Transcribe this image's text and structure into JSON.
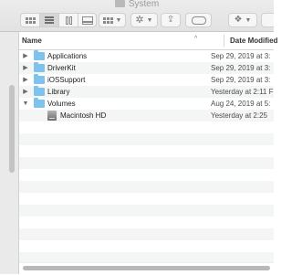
{
  "window": {
    "title": "System"
  },
  "toolbar": {
    "view_modes": [
      {
        "name": "icon-view",
        "icon": "grid-icon",
        "active": false
      },
      {
        "name": "list-view",
        "icon": "list-icon",
        "active": true
      },
      {
        "name": "column-view",
        "icon": "columns-icon",
        "active": false
      },
      {
        "name": "gallery-view",
        "icon": "gallery-icon",
        "active": false
      }
    ],
    "group_icon": "group-grid-icon",
    "action_icon": "gear-icon",
    "share_icon": "share-icon",
    "tag_icon": "tag-icon",
    "dropbox_icon": "dropbox-icon"
  },
  "columns": {
    "name": "Name",
    "date_modified": "Date Modified",
    "sort_indicator": "^"
  },
  "rows": [
    {
      "name": "Applications",
      "date": "Sep 29, 2019 at 3:",
      "disclosure": "▶",
      "icon": "folder-icon"
    },
    {
      "name": "DriverKit",
      "date": "Sep 29, 2019 at 3:",
      "disclosure": "▶",
      "icon": "folder-icon"
    },
    {
      "name": "iOSSupport",
      "date": "Sep 29, 2019 at 3:",
      "disclosure": "▶",
      "icon": "folder-icon"
    },
    {
      "name": "Library",
      "date": "Yesterday at 2:11 F",
      "disclosure": "▶",
      "icon": "folder-icon"
    },
    {
      "name": "Volumes",
      "date": "Aug 24, 2019 at 5:",
      "disclosure": "▼",
      "icon": "folder-icon"
    },
    {
      "name": "Macintosh HD",
      "date": "Yesterday at 2:25",
      "disclosure": "",
      "icon": "disk-icon"
    }
  ],
  "colors": {
    "folder": "#7fc3ec",
    "stripe": "#f4f5f5",
    "toolbar": "#e6e6e6"
  }
}
